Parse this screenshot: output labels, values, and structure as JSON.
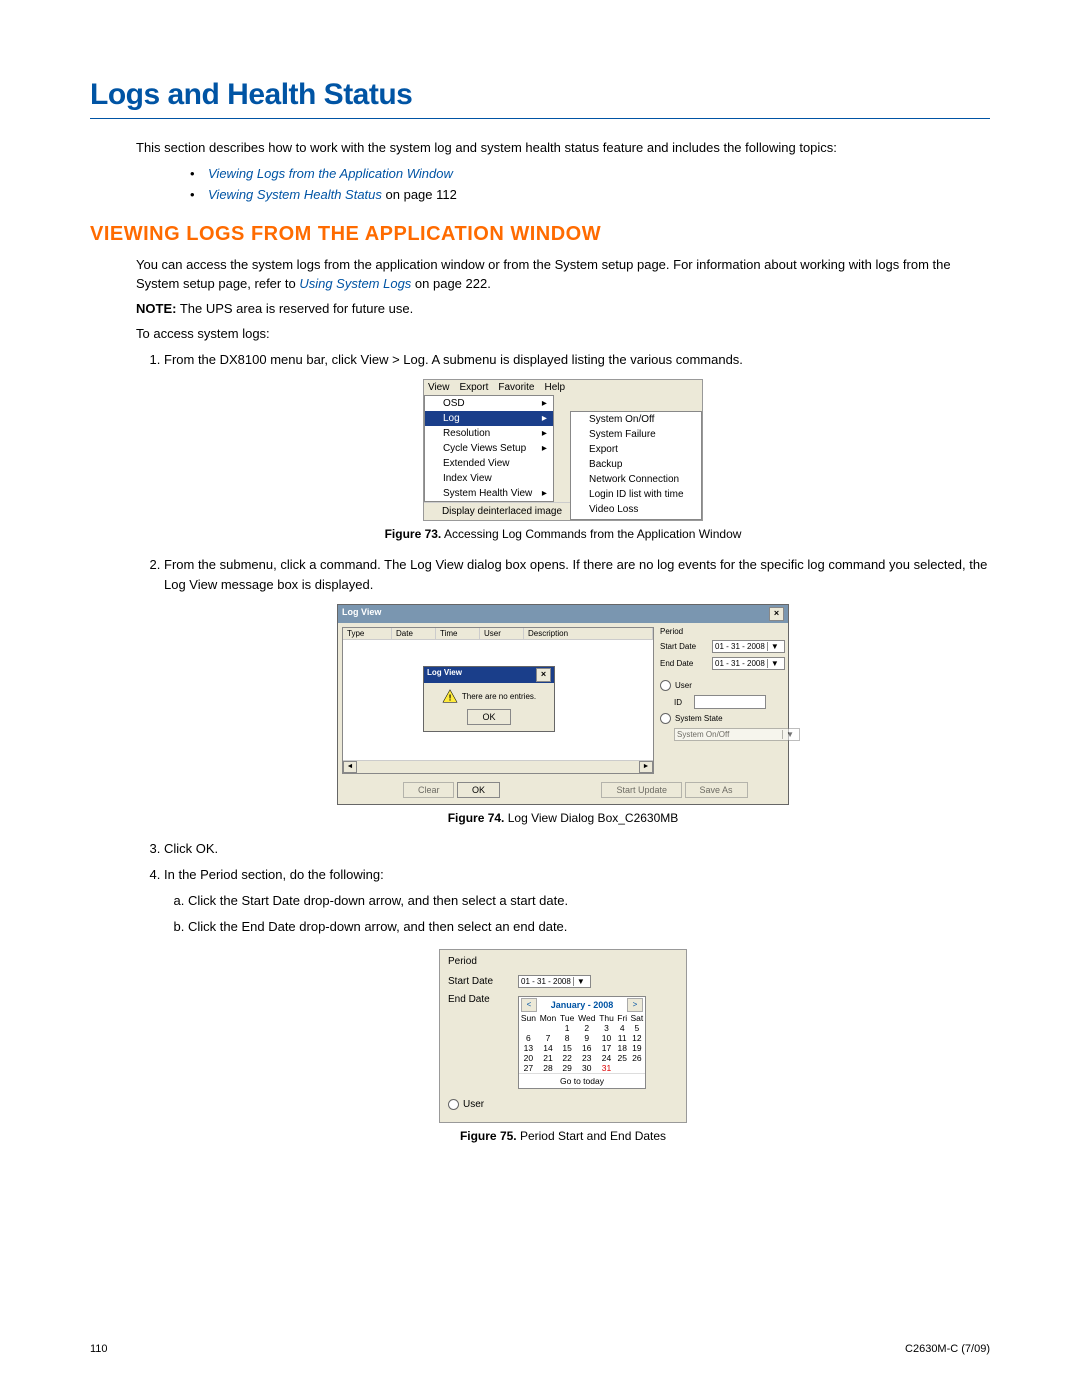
{
  "page": {
    "h1": "Logs and Health Status",
    "intro": "This section describes how to work with the system log and system health status feature and includes the following topics:",
    "bullet1": "Viewing Logs from the Application Window",
    "bullet2_link": "Viewing System Health Status",
    "bullet2_rest": " on page 112",
    "h2": "VIEWING LOGS FROM THE APPLICATION WINDOW",
    "p1a": "You can access the system logs from the application window or from the System setup page. For information about working with logs from the System setup page, refer to ",
    "p1_link": "Using System Logs",
    "p1b": " on page 222.",
    "note_label": "NOTE:",
    "note_text": " The UPS area is reserved for future use.",
    "p_access": "To access system logs:",
    "step1": "From the DX8100 menu bar, click View > Log. A submenu is displayed listing the various commands.",
    "fig73_cap_b": "Figure 73.",
    "fig73_cap": "  Accessing Log Commands from the Application Window",
    "step2": "From the submenu, click a command. The Log View dialog box opens. If there are no log events for the specific log command you selected, the Log View message box is displayed.",
    "fig74_cap_b": "Figure 74.",
    "fig74_cap": "  Log View Dialog Box_C2630MB",
    "step3": "Click OK.",
    "step4": "In the Period section, do the following:",
    "step4a": "Click the Start Date drop-down arrow, and then select a start date.",
    "step4b": "Click the End Date drop-down arrow, and then select an end date.",
    "fig75_cap_b": "Figure 75.",
    "fig75_cap": "  Period Start and End Dates",
    "footer_left": "110",
    "footer_right": "C2630M-C (7/09)"
  },
  "fig73": {
    "menubar": [
      "View",
      "Export",
      "Favorite",
      "Help"
    ],
    "menu": {
      "items": [
        {
          "label": "OSD",
          "arrow": true
        },
        {
          "label": "Log",
          "arrow": true,
          "selected": true
        },
        {
          "label": "Resolution",
          "arrow": true
        },
        {
          "label": "Cycle Views Setup",
          "arrow": true
        },
        {
          "label": "Extended View"
        },
        {
          "label": "Index View"
        },
        {
          "label": "System Health View",
          "arrow": true
        }
      ],
      "footer": "Display deinterlaced image"
    },
    "submenu": [
      "System On/Off",
      "System Failure",
      "Export",
      "Backup",
      "Network Connection",
      "Login ID list with time",
      "Video Loss"
    ]
  },
  "fig74": {
    "title": "Log View",
    "cols": [
      "Type",
      "Date",
      "Time",
      "User",
      "Description"
    ],
    "msg_title": "Log View",
    "msg_text": "There are no entries.",
    "msg_ok": "OK",
    "period": "Period",
    "start": "Start Date",
    "end": "End Date",
    "date1": "01 - 31 - 2008",
    "date2": "01 - 31 - 2008",
    "user": "User",
    "id": "ID",
    "sysstate": "System State",
    "sysval": "System On/Off",
    "btn_clear": "Clear",
    "btn_ok": "OK",
    "btn_start": "Start Update",
    "btn_save": "Save As"
  },
  "fig75": {
    "period": "Period",
    "start": "Start Date",
    "end": "End Date",
    "date": "01 - 31 - 2008",
    "month": "January - 2008",
    "days": [
      "Sun",
      "Mon",
      "Tue",
      "Wed",
      "Thu",
      "Fri",
      "Sat"
    ],
    "weeks": [
      [
        "",
        "",
        "1",
        "2",
        "3",
        "4",
        "5"
      ],
      [
        "6",
        "7",
        "8",
        "9",
        "10",
        "11",
        "12"
      ],
      [
        "13",
        "14",
        "15",
        "16",
        "17",
        "18",
        "19"
      ],
      [
        "20",
        "21",
        "22",
        "23",
        "24",
        "25",
        "26"
      ],
      [
        "27",
        "28",
        "29",
        "30",
        "31",
        "",
        ""
      ]
    ],
    "today_col": 4,
    "goto": "Go to today",
    "user": "User"
  }
}
